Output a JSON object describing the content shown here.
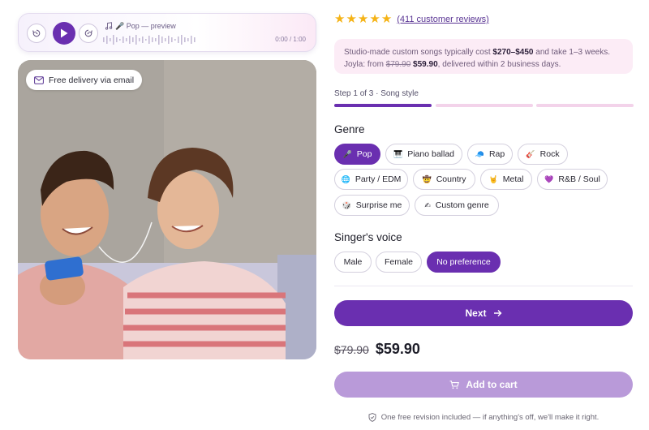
{
  "player": {
    "track_label": "🎤 Pop — preview",
    "time": "0:00 / 1:00",
    "icons": [
      "rewind-icon",
      "play-icon",
      "forward-icon",
      "music-note-icon"
    ]
  },
  "hero": {
    "badge_text": "Free delivery via email",
    "badge_icon": "mail-icon"
  },
  "rating": {
    "stars": 5,
    "reviews_text": "(411 customer reviews)"
  },
  "promo": {
    "line1_a": "Studio-made custom songs typically cost ",
    "line1_price": "$270–$450",
    "line1_b": " and take 1–3 weeks.",
    "line2_a": "Joyla: from ",
    "line2_old": "$79.90",
    "line2_new": " $59.90",
    "line2_b": ", delivered within 2 business days."
  },
  "steps": {
    "label": "Step 1 of 3 · Song style",
    "total": 3,
    "current": 1
  },
  "genre": {
    "title": "Genre",
    "selected": "Pop",
    "options": [
      {
        "icon": "🎤",
        "label": "Pop"
      },
      {
        "icon": "🎹",
        "label": "Piano ballad"
      },
      {
        "icon": "🧢",
        "label": "Rap"
      },
      {
        "icon": "🎸",
        "label": "Rock"
      },
      {
        "icon": "🌐",
        "label": "Party / EDM"
      },
      {
        "icon": "🤠",
        "label": "Country"
      },
      {
        "icon": "🤘",
        "label": "Metal"
      },
      {
        "icon": "💜",
        "label": "R&B / Soul"
      },
      {
        "icon": "🎲",
        "label": "Surprise me"
      },
      {
        "icon": "✍",
        "label": "Custom genre"
      }
    ]
  },
  "voice": {
    "title": "Singer's voice",
    "selected": "No preference",
    "options": [
      "Male",
      "Female",
      "No preference"
    ]
  },
  "actions": {
    "next_label": "Next",
    "price_old": "$79.90",
    "price_new": "$59.90",
    "cart_label": "Add to cart",
    "guarantee": "One free revision included — if anything's off, we'll make it right."
  },
  "colors": {
    "accent": "#6a2fb0",
    "accent_light": "#b99ad9",
    "star": "#f5b316",
    "promo_bg": "#fcecf6"
  }
}
